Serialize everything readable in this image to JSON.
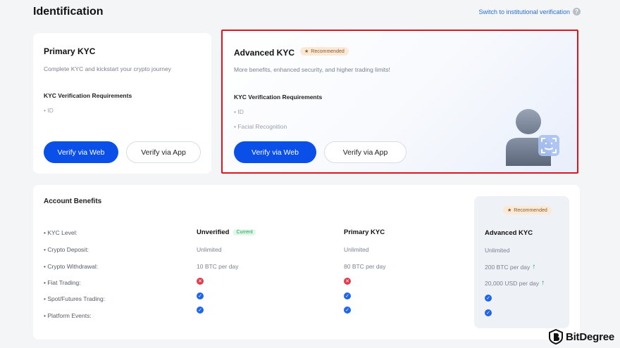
{
  "page": {
    "title": "Identification",
    "institutional_link": "Switch to institutional verification"
  },
  "primary_card": {
    "title": "Primary KYC",
    "description": "Complete KYC and kickstart your crypto journey",
    "requirements_title": "KYC Verification Requirements",
    "requirements": [
      "• ID"
    ],
    "verify_web": "Verify via Web",
    "verify_app": "Verify via App"
  },
  "advanced_card": {
    "title": "Advanced KYC",
    "badge": "Recommended",
    "description": "More benefits, enhanced security, and higher trading limits!",
    "requirements_title": "KYC Verification Requirements",
    "requirements": [
      "• ID",
      "• Facial Recognition"
    ],
    "verify_web": "Verify via Web",
    "verify_app": "Verify via App"
  },
  "benefits": {
    "title": "Account Benefits",
    "rows": [
      "• KYC Level:",
      "• Crypto Deposit:",
      "• Crypto Withdrawal:",
      "• Fiat Trading:",
      "• Spot/Futures Trading:",
      "• Platform Events:"
    ],
    "unverified": {
      "head": "Unverified",
      "badge": "Current",
      "deposit": "Unlimited",
      "withdrawal": "10 BTC per day",
      "fiat": "no",
      "spot": "yes",
      "events": "yes"
    },
    "primary": {
      "head": "Primary KYC",
      "deposit": "Unlimited",
      "withdrawal": "80 BTC per day",
      "fiat": "no",
      "spot": "yes",
      "events": "yes"
    },
    "advanced": {
      "badge": "Recommended",
      "head": "Advanced KYC",
      "deposit": "Unlimited",
      "withdrawal": "200 BTC per day",
      "fiat": "20,000 USD per day",
      "spot": "yes",
      "events": "yes"
    }
  },
  "watermark": {
    "text": "BitDegree"
  },
  "colors": {
    "accent": "#0a4fe8",
    "highlight_border": "#e0141c",
    "success": "#19a35a",
    "error": "#e23b4b",
    "check": "#1f66e8"
  },
  "icons": [
    "help-icon",
    "star-icon",
    "check-circle-icon",
    "x-circle-icon",
    "arrow-up-icon",
    "face-id-avatar-illustration",
    "bitdegree-logo"
  ]
}
